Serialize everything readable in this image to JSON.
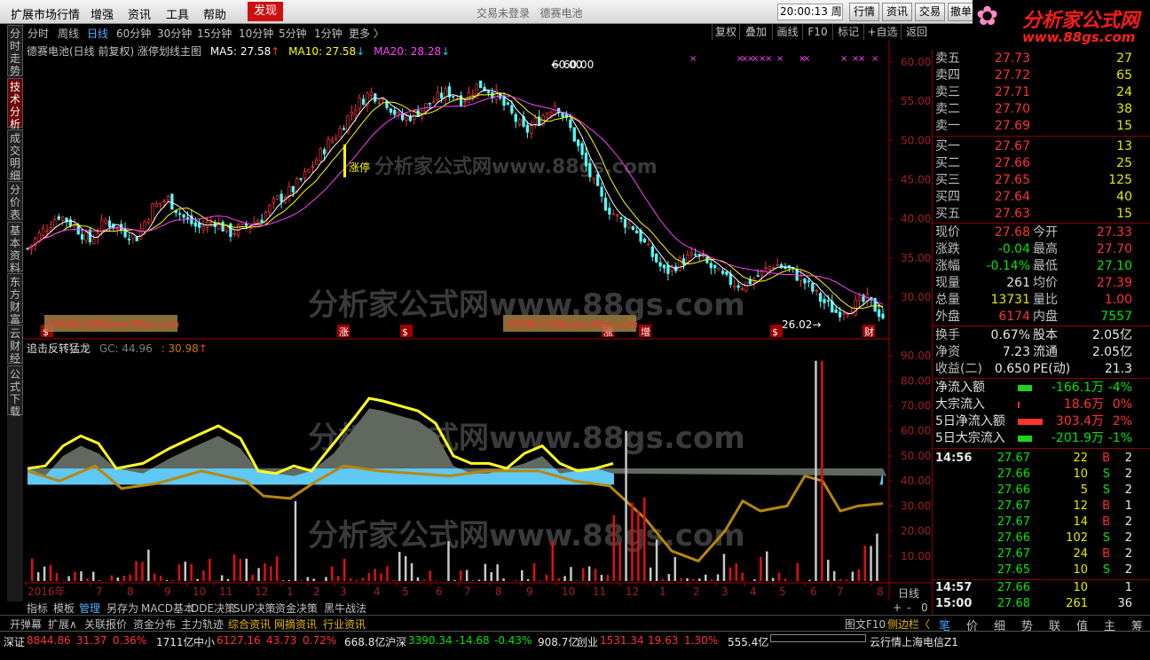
{
  "menu": {
    "items": [
      "扩展市场行情",
      "增强",
      "资讯",
      "工具",
      "帮助"
    ],
    "discover": "发现",
    "status": "交易未登录",
    "stock_name": "德赛电池",
    "clock": "20:00:13 周一",
    "buttons": [
      "行情",
      "资讯",
      "交易",
      "撤单"
    ]
  },
  "logo": {
    "flower": "✿",
    "text": "分析家公式网",
    "url": "www.88gs.com"
  },
  "side_tabs": [
    {
      "label": "分时走势",
      "active": false
    },
    {
      "label": "技术分析",
      "active": true
    },
    {
      "label": "成交明细",
      "active": false
    },
    {
      "label": "分价表",
      "active": false
    },
    {
      "label": "基本资料",
      "active": false
    },
    {
      "label": "东方财富",
      "active": false
    },
    {
      "label": "云财经",
      "active": false
    },
    {
      "label": "公式下载",
      "active": false
    }
  ],
  "periods": [
    {
      "label": "分时",
      "active": false
    },
    {
      "label": "周线",
      "active": false
    },
    {
      "label": "日线",
      "active": true
    },
    {
      "label": "60分钟",
      "active": false
    },
    {
      "label": "30分钟",
      "active": false
    },
    {
      "label": "15分钟",
      "active": false
    },
    {
      "label": "10分钟",
      "active": false
    },
    {
      "label": "5分钟",
      "active": false
    },
    {
      "label": "1分钟",
      "active": false
    },
    {
      "label": "更多 〉",
      "active": false
    }
  ],
  "toolbar": [
    "复权",
    "叠加",
    "画线",
    "F10",
    "标记",
    "+自选",
    "返回"
  ],
  "chart_title": {
    "main": "德赛电池(日线 前复权) 涨停划线主图",
    "ma5": "MA5: 27.58",
    "ma10": "MA10: 27.58",
    "ma20": "MA20: 28.28",
    "arrow_up": "↑",
    "arrow_dn": "↓"
  },
  "indicator_title": {
    "name": "追击反转猛龙",
    "gc": "GC: 44.96",
    "val": ": 30.98",
    "arrow": "↑"
  },
  "watermark": "分析家公式网www.88gs.com",
  "watermark_small": "分析家公式网www.88gs.com",
  "colors": {
    "up": "#ff3232",
    "down": "#00e600",
    "ma5": "#ffffff",
    "ma10": "#ffff00",
    "ma20": "#ff40ff",
    "gold": "#b8860b",
    "yellow": "#ffff20",
    "sky": "#5fc8f5"
  },
  "chart_data": {
    "type": "candlestick",
    "y_ticks": [
      "60.00",
      "55.00",
      "50.00",
      "45.00",
      "40.00",
      "35.00",
      "30.00"
    ],
    "x_ticks": [
      "2016年",
      "7",
      "8",
      "9",
      "10",
      "11",
      "12",
      "1",
      "2",
      "3",
      "4",
      "5",
      "6",
      "7",
      "8",
      "9",
      "10",
      "11",
      "12",
      "1",
      "2",
      "3",
      "4",
      "5",
      "6",
      "7",
      "8"
    ],
    "ind_ticks": [
      "90.00",
      "80.00",
      "70.00",
      "60.00",
      "50.00",
      "40.00",
      "30.00",
      "20.00",
      "10.00"
    ],
    "high_label": "60.00",
    "low_label": "26.02",
    "limit_label": "涨停",
    "price_path": [
      [
        0,
        36.2
      ],
      [
        2,
        38.5
      ],
      [
        4,
        40.5
      ],
      [
        6,
        39.2
      ],
      [
        8,
        37.1
      ],
      [
        10,
        39.8
      ],
      [
        12,
        38.6
      ],
      [
        14,
        37.6
      ],
      [
        16,
        41.4
      ],
      [
        18,
        42.6
      ],
      [
        20,
        40.2
      ],
      [
        22,
        38.8
      ],
      [
        24,
        39.8
      ],
      [
        26,
        38.2
      ],
      [
        28,
        39.1
      ],
      [
        30,
        40.0
      ],
      [
        32,
        42.4
      ],
      [
        34,
        43.6
      ],
      [
        36,
        45.9
      ],
      [
        38,
        48.8
      ],
      [
        40,
        51.1
      ],
      [
        42,
        54.2
      ],
      [
        44,
        56.1
      ],
      [
        46,
        55.1
      ],
      [
        48,
        52.6
      ],
      [
        50,
        53.5
      ],
      [
        52,
        54.9
      ],
      [
        54,
        56.2
      ],
      [
        56,
        55.1
      ],
      [
        58,
        57.2
      ],
      [
        60,
        56.0
      ],
      [
        62,
        53.6
      ],
      [
        64,
        51.0
      ],
      [
        66,
        52.9
      ],
      [
        68,
        54.8
      ],
      [
        70,
        51.1
      ],
      [
        72,
        46.2
      ],
      [
        74,
        42.1
      ],
      [
        76,
        40.0
      ],
      [
        78,
        38.9
      ],
      [
        80,
        35.8
      ],
      [
        82,
        33.1
      ],
      [
        84,
        34.6
      ],
      [
        86,
        35.4
      ],
      [
        88,
        33.7
      ],
      [
        90,
        32.1
      ],
      [
        92,
        31.5
      ],
      [
        94,
        32.8
      ],
      [
        96,
        34.3
      ],
      [
        98,
        33.5
      ],
      [
        100,
        31.9
      ],
      [
        102,
        29.7
      ],
      [
        104,
        28.1
      ],
      [
        106,
        28.9
      ],
      [
        108,
        29.6
      ],
      [
        110,
        27.6
      ]
    ],
    "markers": [
      "涨",
      "$",
      "涨",
      "增",
      "$",
      "财"
    ],
    "volume_bars_note": "red=up, white=down"
  },
  "right": {
    "asks": [
      {
        "l": "卖五",
        "p": "27.73",
        "v": "27"
      },
      {
        "l": "卖四",
        "p": "27.72",
        "v": "65"
      },
      {
        "l": "卖三",
        "p": "27.71",
        "v": "24"
      },
      {
        "l": "卖二",
        "p": "27.70",
        "v": "38"
      },
      {
        "l": "卖一",
        "p": "27.69",
        "v": "15"
      }
    ],
    "bids": [
      {
        "l": "买一",
        "p": "27.67",
        "v": "13"
      },
      {
        "l": "买二",
        "p": "27.66",
        "v": "25"
      },
      {
        "l": "买三",
        "p": "27.65",
        "v": "125"
      },
      {
        "l": "买四",
        "p": "27.64",
        "v": "40"
      },
      {
        "l": "买五",
        "p": "27.63",
        "v": "15"
      }
    ],
    "quote": [
      {
        "l1": "现价",
        "v1": "27.68",
        "c1": "up",
        "l2": "今开",
        "v2": "27.33",
        "c2": "up"
      },
      {
        "l1": "涨跌",
        "v1": "-0.04",
        "c1": "dn",
        "l2": "最高",
        "v2": "27.70",
        "c2": "up"
      },
      {
        "l1": "涨幅",
        "v1": "-0.14%",
        "c1": "dn",
        "l2": "最低",
        "v2": "27.10",
        "c2": "dn"
      },
      {
        "l1": "现量",
        "v1": "261",
        "c1": "wh",
        "l2": "均价",
        "v2": "27.39",
        "c2": "up"
      },
      {
        "l1": "总量",
        "v1": "13731",
        "c1": "ye",
        "l2": "量比",
        "v2": "1.00",
        "c2": "up"
      },
      {
        "l1": "外盘",
        "v1": "6174",
        "c1": "up",
        "l2": "内盘",
        "v2": "7557",
        "c2": "dn"
      }
    ],
    "fund": [
      {
        "l1": "换手",
        "v1": "0.67%",
        "l2": "股本",
        "v2": "2.05亿"
      },
      {
        "l1": "净资",
        "v1": "7.23",
        "l2": "流通",
        "v2": "2.05亿"
      },
      {
        "l1": "收益(二)",
        "v1": "0.650",
        "l2": "PE(动)",
        "v2": "21.3"
      }
    ],
    "flows": [
      {
        "l": "净流入额",
        "v": "-166.1万",
        "p": "-4%",
        "c": "dn",
        "bar": "dn"
      },
      {
        "l": "大宗流入",
        "v": "18.6万",
        "p": "0%",
        "c": "up",
        "bar": "tick"
      },
      {
        "l": "5日净流入额",
        "v": "303.4万",
        "p": "2%",
        "c": "up",
        "bar": "up"
      },
      {
        "l": "5日大宗流入",
        "v": "-201.9万",
        "p": "-1%",
        "c": "dn",
        "bar": "dn"
      }
    ],
    "ticks_time": "14:56",
    "ticks": [
      {
        "t": "14:56",
        "p": "27.67",
        "v": "22",
        "s": "B",
        "n": "2"
      },
      {
        "t": "",
        "p": "27.66",
        "v": "10",
        "s": "S",
        "n": "2"
      },
      {
        "t": "",
        "p": "27.66",
        "v": "5",
        "s": "S",
        "n": "2"
      },
      {
        "t": "",
        "p": "27.67",
        "v": "12",
        "s": "B",
        "n": "1"
      },
      {
        "t": "",
        "p": "27.67",
        "v": "14",
        "s": "B",
        "n": "2"
      },
      {
        "t": "",
        "p": "27.66",
        "v": "102",
        "s": "S",
        "n": "2"
      },
      {
        "t": "",
        "p": "27.67",
        "v": "24",
        "s": "B",
        "n": "2"
      },
      {
        "t": "",
        "p": "27.65",
        "v": "10",
        "s": "S",
        "n": "2"
      },
      {
        "t": "14:57",
        "p": "27.66",
        "v": "10",
        "s": "",
        "n": "1"
      },
      {
        "t": "15:00",
        "p": "27.68",
        "v": "261",
        "s": "",
        "n": "36"
      }
    ]
  },
  "ind_controls": {
    "period": "日线",
    "plus": "+",
    "minus": "-",
    "zero": "0"
  },
  "bottom_tabs": [
    {
      "label": "指标",
      "active": false
    },
    {
      "label": "模板",
      "active": false
    },
    {
      "label": "管理",
      "active": true
    },
    {
      "label": "另存为",
      "active": false
    },
    {
      "label": "MACD基本",
      "active": false
    },
    {
      "label": "DDE决策",
      "active": false
    },
    {
      "label": "SUP决策",
      "active": false
    },
    {
      "label": "资金决策",
      "active": false
    },
    {
      "label": "黑牛战法",
      "active": false
    }
  ],
  "bar2": {
    "left": [
      "开弹幕",
      "扩展∧",
      "关联报价",
      "资金分布",
      "主力轨迹",
      "综合资讯",
      "网摘资讯",
      "行业资讯"
    ],
    "right": [
      "图文F10",
      "侧边栏〈"
    ],
    "icons": [
      "笔",
      "价",
      "细",
      "势",
      "联",
      "值",
      "主",
      "筹"
    ]
  },
  "status": {
    "sz": "深证",
    "sz_v": "8844.86",
    "sz_c": "31.37",
    "sz_p": "0.36%",
    "sz_a": "1711亿",
    "zx": "中小",
    "zx_v": "6127.16",
    "zx_c": "43.73",
    "zx_p": "0.72%",
    "zx_a": "668.8亿",
    "hs": "沪深",
    "hs_v": "3390.34",
    "hs_c": "-14.68",
    "hs_p": "-0.43%",
    "hs_a": "908.7亿",
    "cy": "创业",
    "cy_v": "1531.34",
    "cy_c": "19.63",
    "cy_p": "1.30%",
    "cy_a": "555.4亿",
    "server": "云行情上海电信Z1"
  }
}
